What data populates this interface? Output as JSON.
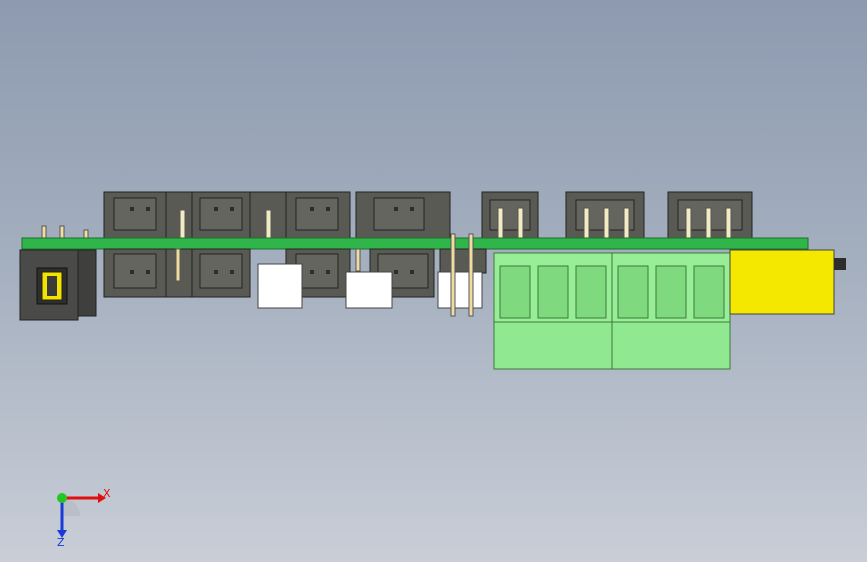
{
  "viewport": {
    "background_top": "#8e9ab0",
    "background_bottom": "#c9ced7"
  },
  "model": {
    "pcb_color": "#2fb54a",
    "connector_color": "#5a5a55",
    "terminal_block_color": "#97ee97",
    "yellow_part_color": "#f5e800",
    "white_part_color": "#ffffff"
  },
  "triad": {
    "x_label": "X",
    "z_label": "Z",
    "x_color": "#e01010",
    "z_color": "#1a3ad8",
    "y_color": "#22c822"
  }
}
